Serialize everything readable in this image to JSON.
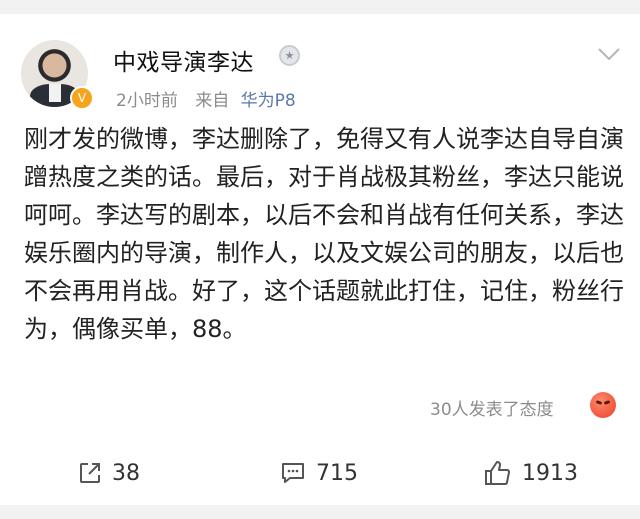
{
  "post": {
    "author": "中戏导演李达",
    "time": "2小时前",
    "source_prefix": "来自",
    "source": "华为P8",
    "content": "刚才发的微博，李达删除了，免得又有人说李达自导自演蹭热度之类的话。最后，对于肖战极其粉丝，李达只能说呵呵。李达写的剧本，以后不会和肖战有任何关系，李达娱乐圈内的导演，制作人，以及文娱公司的朋友，以后也不会再用肖战。好了，这个话题就此打住，记住，粉丝行为，偶像买单，88。",
    "attitude_text": "30人发表了态度"
  },
  "actions": {
    "repost_count": "38",
    "comment_count": "715",
    "like_count": "1913"
  },
  "icons": {
    "avatar_badge": "verified-v-icon",
    "medal": "medal-icon",
    "menu": "chevron-down-icon",
    "reaction": "angry-face-icon",
    "repost": "share-icon",
    "comment": "comment-icon",
    "like": "thumbs-up-icon"
  },
  "colors": {
    "badge": "#f7a31d",
    "source_link": "#5b79a9",
    "meta": "#8c8c8c"
  }
}
